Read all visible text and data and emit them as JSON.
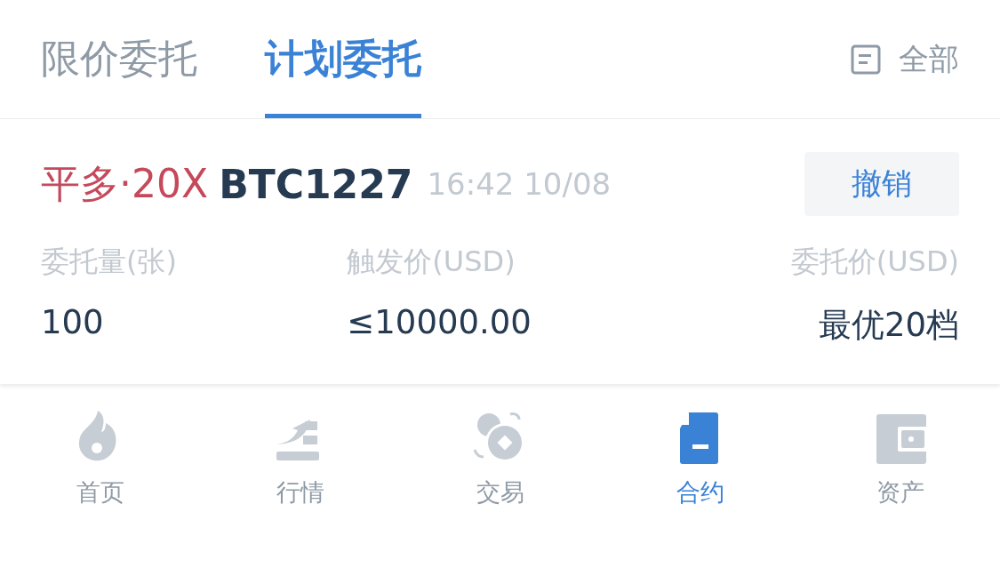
{
  "tabs": [
    {
      "label": "限价委托",
      "selected": false
    },
    {
      "label": "计划委托",
      "selected": true
    }
  ],
  "filter": {
    "label": "全部"
  },
  "orders": [
    {
      "side": "平多·20X",
      "symbol": "BTC1227",
      "time": "16:42 10/08",
      "cancel": "撤销",
      "fields": [
        {
          "label": "委托量(张)",
          "value": "100"
        },
        {
          "label": "触发价(USD)",
          "value": "≤10000.00"
        },
        {
          "label": "委托价(USD)",
          "value": "最优20档"
        }
      ]
    }
  ],
  "nav": [
    {
      "label": "首页",
      "selected": false
    },
    {
      "label": "行情",
      "selected": false
    },
    {
      "label": "交易",
      "selected": false
    },
    {
      "label": "合约",
      "selected": true
    },
    {
      "label": "资产",
      "selected": false
    }
  ]
}
